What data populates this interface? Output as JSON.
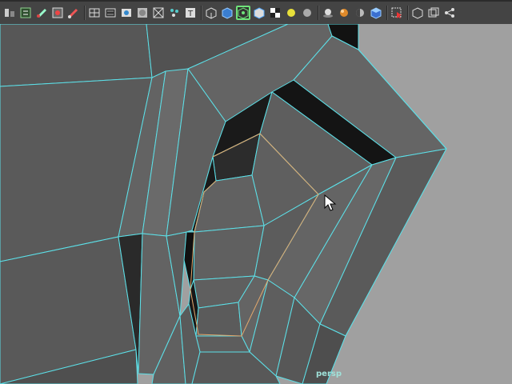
{
  "toolbar": {
    "buttons": [
      {
        "icon": "hypergraph-icon"
      },
      {
        "icon": "outliner-icon"
      },
      {
        "icon": "paint-tool-icon"
      },
      {
        "icon": "render-settings-icon"
      },
      {
        "icon": "brush-icon"
      },
      {
        "separator": true
      },
      {
        "icon": "wireframe-icon"
      },
      {
        "icon": "smooth-shade-icon"
      },
      {
        "icon": "shaded-wire-icon"
      },
      {
        "icon": "bounding-box-icon"
      },
      {
        "icon": "xray-icon"
      },
      {
        "icon": "isolate-select-icon"
      },
      {
        "icon": "textured-icon"
      },
      {
        "separator": true
      },
      {
        "icon": "cube-outline-icon"
      },
      {
        "icon": "cube-shaded-icon"
      },
      {
        "icon": "cube-selected-icon",
        "active": true
      },
      {
        "icon": "cube-textured-icon"
      },
      {
        "icon": "checker-icon"
      },
      {
        "icon": "light-sphere-icon"
      },
      {
        "icon": "grey-sphere-icon"
      },
      {
        "separator": true
      },
      {
        "icon": "lights-icon"
      },
      {
        "icon": "shadow-sphere-icon"
      },
      {
        "icon": "half-sphere-icon"
      },
      {
        "icon": "material-cube-icon"
      },
      {
        "separator": true
      },
      {
        "icon": "select-region-icon"
      },
      {
        "separator": true
      },
      {
        "icon": "frame-all-icon"
      },
      {
        "icon": "frame-selected-icon"
      },
      {
        "icon": "graph-node-icon"
      }
    ]
  },
  "viewport": {
    "camera_label": "persp",
    "background_color": "#a0a0a0",
    "wire_color": "#5ce0e8",
    "selected_edge_color": "#e3a86c",
    "face_color": "#5d5d5d"
  }
}
